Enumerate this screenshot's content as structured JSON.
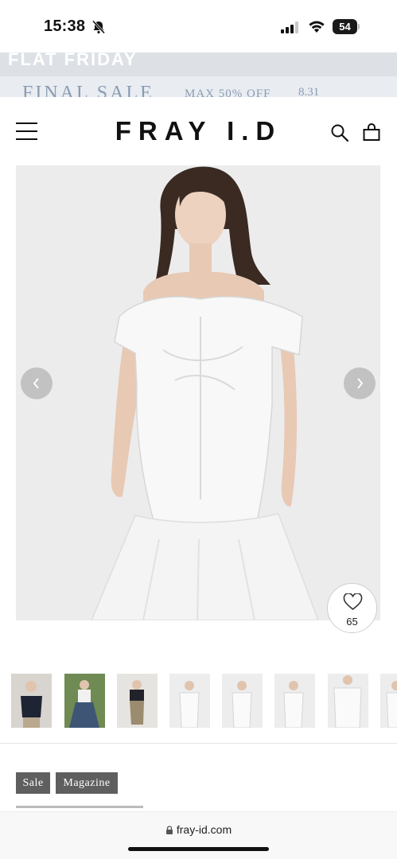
{
  "status_bar": {
    "time": "15:38",
    "battery": "54",
    "icons": [
      "bell-slash-icon",
      "signal-icon",
      "wifi-icon",
      "battery-icon"
    ]
  },
  "promo": {
    "top_text": "FLAT FRIDAY",
    "final_title": "FINAL SALE",
    "final_sub": "MAX 50% OFF",
    "final_date": "8.31",
    "colors": {
      "banner_bg": "#dde1e6",
      "final_text": "#8a9bb3"
    }
  },
  "header": {
    "brand": "FRAY I.D",
    "icons": [
      "menu-icon",
      "search-icon",
      "bag-icon"
    ]
  },
  "gallery": {
    "prev_icon": "chevron-left-icon",
    "next_icon": "chevron-right-icon",
    "favorites_count": "65",
    "thumbnail_count": 8
  },
  "tags": [
    "Sale",
    "Magazine"
  ],
  "browser": {
    "url": "fray-id.com"
  }
}
